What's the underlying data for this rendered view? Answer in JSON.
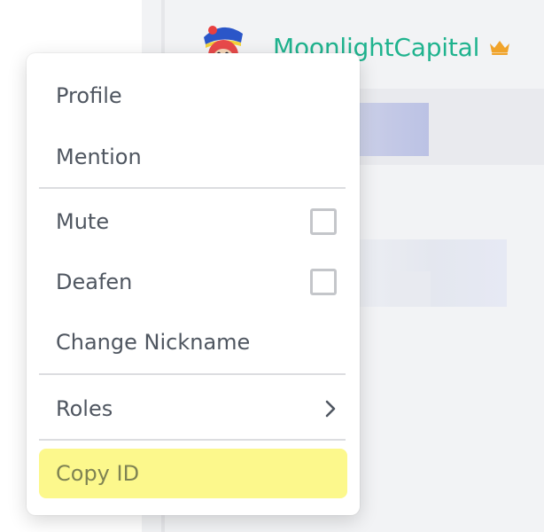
{
  "user": {
    "name": "MoonlightCapital",
    "name_color": "#1fb38e",
    "crown_color": "#f0a32a"
  },
  "context_menu": {
    "items": [
      {
        "label": "Profile"
      },
      {
        "label": "Mention"
      },
      {
        "label": "Mute",
        "control": "checkbox",
        "checked": false
      },
      {
        "label": "Deafen",
        "control": "checkbox",
        "checked": false
      },
      {
        "label": "Change Nickname"
      },
      {
        "label": "Roles",
        "control": "chevron-right"
      },
      {
        "label": "Copy ID",
        "highlighted": true,
        "highlight_color": "#fcf88c"
      }
    ]
  }
}
